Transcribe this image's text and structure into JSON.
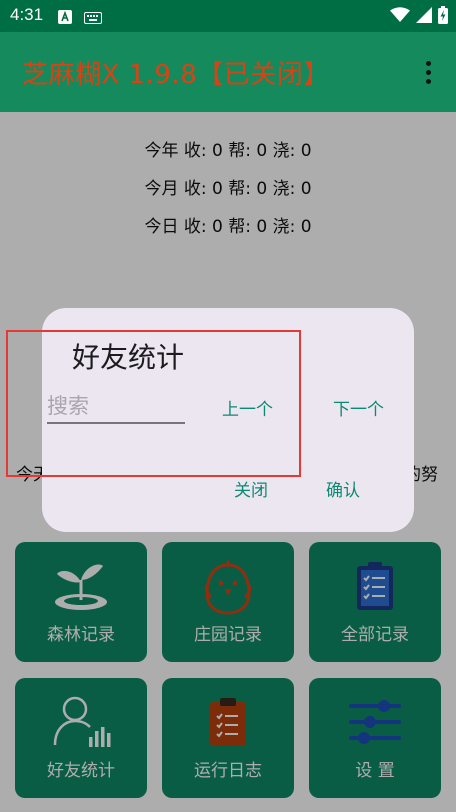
{
  "status_bar": {
    "time": "4:31"
  },
  "app_bar": {
    "title": "芝麻糊X 1.9.8【已关闭】"
  },
  "stats": {
    "rows": [
      "今年  收: 0 帮: 0 浇: 0",
      "今月  收: 0 帮: 0 浇: 0",
      "今日  收: 0 帮: 0 浇: 0"
    ]
  },
  "background_text": {
    "left": "今天",
    "right": "的努"
  },
  "tiles": [
    {
      "label": "森林记录"
    },
    {
      "label": "庄园记录"
    },
    {
      "label": "全部记录"
    },
    {
      "label": "好友统计"
    },
    {
      "label": "运行日志"
    },
    {
      "label": "设 置"
    }
  ],
  "dialog": {
    "title": "好友统计",
    "search_placeholder": "搜索",
    "prev_label": "上一个",
    "next_label": "下一个",
    "close_label": "关闭",
    "confirm_label": "确认"
  },
  "colors": {
    "status_bar": "#006E45",
    "app_bar": "#158A5C",
    "title": "#D84315",
    "tile": "#0F8A66",
    "dialog_bg": "#ECE6F0",
    "dialog_text_button": "#0B8A73",
    "annotation": "#E53935"
  }
}
